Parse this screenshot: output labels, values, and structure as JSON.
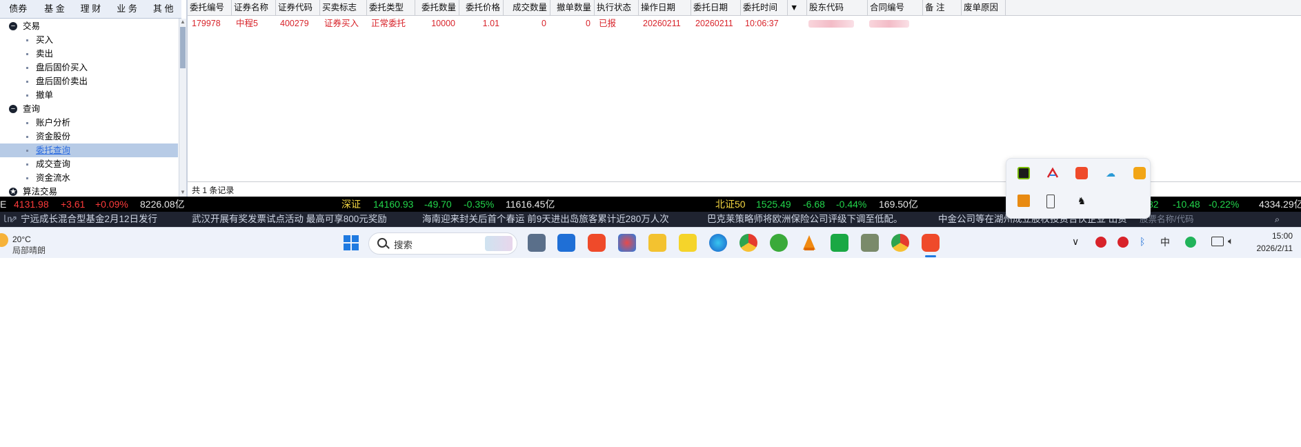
{
  "nav_tabs": [
    "债券",
    "基 金",
    "理 财",
    "业 务",
    "其 他"
  ],
  "tree": [
    {
      "type": "parent",
      "label": "交易",
      "sym": "−"
    },
    {
      "type": "child",
      "label": "买入"
    },
    {
      "type": "child",
      "label": "卖出"
    },
    {
      "type": "child",
      "label": "盘后固价买入"
    },
    {
      "type": "child",
      "label": "盘后固价卖出"
    },
    {
      "type": "child",
      "label": "撤单"
    },
    {
      "type": "parent",
      "label": "查询",
      "sym": "−"
    },
    {
      "type": "child",
      "label": "账户分析"
    },
    {
      "type": "child",
      "label": "资金股份"
    },
    {
      "type": "child",
      "label": "委托查询",
      "selected": true
    },
    {
      "type": "child",
      "label": "成交查询"
    },
    {
      "type": "child",
      "label": "资金流水"
    },
    {
      "type": "parent",
      "label": "算法交易",
      "sym": "★"
    }
  ],
  "grid": {
    "headers": [
      "委托编号",
      "证券名称",
      "证券代码",
      "买卖标志",
      "委托类型",
      "委托数量",
      "委托价格",
      "成交数量",
      "撤单数量",
      "执行状态",
      "操作日期",
      "委托日期",
      "委托时间",
      "▼",
      "股东代码",
      "合同编号",
      "备 注",
      "废单原因"
    ],
    "row": [
      "179978",
      "中程5",
      "400279",
      "证券买入",
      "正常委托",
      "10000",
      "1.01",
      "0",
      "0",
      "已报",
      "20260211",
      "20260211",
      "10:06:37",
      "",
      "",
      "",
      "",
      ""
    ],
    "footer": "共 1 条记录"
  },
  "index_bar": [
    {
      "text": "E",
      "cls": "white"
    },
    {
      "text": "4131.98",
      "cls": "red"
    },
    {
      "text": "+3.61",
      "cls": "red"
    },
    {
      "text": "+0.09%",
      "cls": "red"
    },
    {
      "text": "8226.08亿",
      "cls": "white"
    },
    {
      "text": "深证",
      "cls": "yellow"
    },
    {
      "text": "14160.93",
      "cls": "green"
    },
    {
      "text": "-49.70",
      "cls": "green"
    },
    {
      "text": "-0.35%",
      "cls": "green"
    },
    {
      "text": "11616.45亿",
      "cls": "white"
    },
    {
      "text": "北证50",
      "cls": "yellow"
    },
    {
      "text": "1525.49",
      "cls": "green"
    },
    {
      "text": "-6.68",
      "cls": "green"
    },
    {
      "text": "-0.44%",
      "cls": "green"
    },
    {
      "text": "169.50亿",
      "cls": "white"
    },
    {
      "text": "82",
      "cls": "green"
    },
    {
      "text": "-10.48",
      "cls": "green"
    },
    {
      "text": "-0.22%",
      "cls": "green"
    },
    {
      "text": "4334.29亿",
      "cls": "white"
    }
  ],
  "news": [
    "宁远成长混合型基金2月12日发行",
    "武汉开展有奖发票试点活动 最高可享800元奖励",
    "海南迎来封关后首个春运 前9天进出岛旅客累计近280万人次",
    "巴克莱策略师将欧洲保险公司评级下调至低配。",
    "中金公司等在湖州成立股权投资合伙企业 出资"
  ],
  "news_search_placeholder": "股票名称/代码",
  "weather": {
    "temp": "20°C",
    "desc": "局部晴朗"
  },
  "taskbar_search": "搜索",
  "clock": {
    "time": "15:00",
    "date": "2026/2/11"
  },
  "tray": {
    "ime": "中"
  },
  "colors": {
    "accent": "#d8232a",
    "up": "#ff3b3b",
    "down": "#22d64b"
  }
}
